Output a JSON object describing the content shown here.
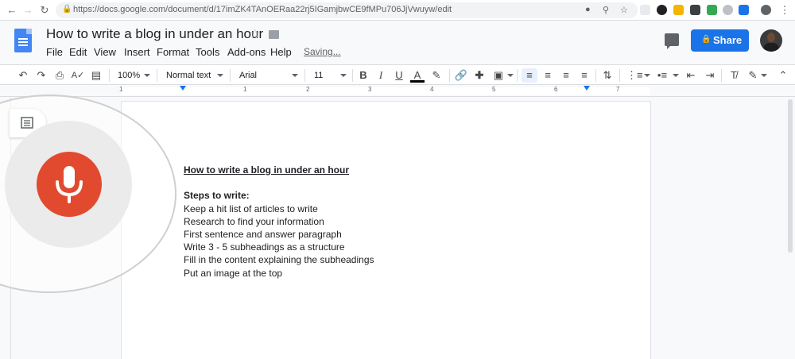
{
  "browser": {
    "url": "https://docs.google.com/document/d/17imZK4TAnOERaa22rj5IGamjbwCE9fMPu706JjVwuyw/edit",
    "nav_icons": [
      "back-icon",
      "forward-icon",
      "reload-icon"
    ],
    "extension_colors": [
      "#5f6368",
      "#202124",
      "#f4b400",
      "#fbbc04",
      "#34a853",
      "#9aa0a6",
      "#1a73e8",
      "#5f6368"
    ]
  },
  "docs": {
    "title": "How to write a blog in under an hour",
    "menu": [
      "File",
      "Edit",
      "View",
      "Insert",
      "Format",
      "Tools",
      "Add-ons",
      "Help"
    ],
    "save_status": "Saving...",
    "share_label": "Share",
    "brand_color": "#1a73e8"
  },
  "toolbar": {
    "zoom": "100%",
    "style": "Normal text",
    "font": "Arial",
    "size": "11",
    "bold": "B",
    "italic": "I",
    "underline": "U",
    "text_color": "A"
  },
  "ruler": {
    "numbers": [
      "1",
      "1",
      "2",
      "3",
      "4",
      "5",
      "6",
      "7"
    ]
  },
  "document": {
    "heading": "How to write a blog in under an hour",
    "subheading": "Steps to write:",
    "lines": [
      "Keep a hit list of articles to write",
      "Research to find your information",
      "First sentence and answer paragraph",
      "Write 3 - 5 subheadings as a structure",
      "Fill in the content explaining the subheadings",
      "Put an image at the top"
    ]
  },
  "voice_typing": {
    "mic_color": "#e24a2f",
    "icon": "microphone-icon"
  }
}
